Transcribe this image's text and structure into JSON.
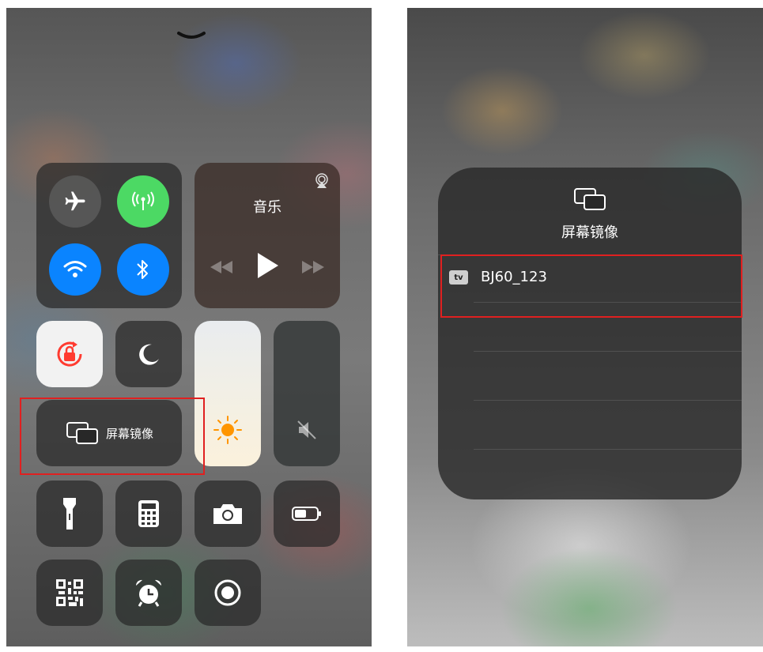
{
  "left": {
    "music": {
      "title": "音乐"
    },
    "screen_mirroring": {
      "label": "屏幕镜像"
    }
  },
  "right": {
    "title": "屏幕镜像",
    "devices": [
      {
        "badge": "tv",
        "name": "BJ60_123"
      }
    ]
  },
  "colors": {
    "green": "#4cd964",
    "blue": "#0a84ff",
    "highlight": "#e02020"
  }
}
